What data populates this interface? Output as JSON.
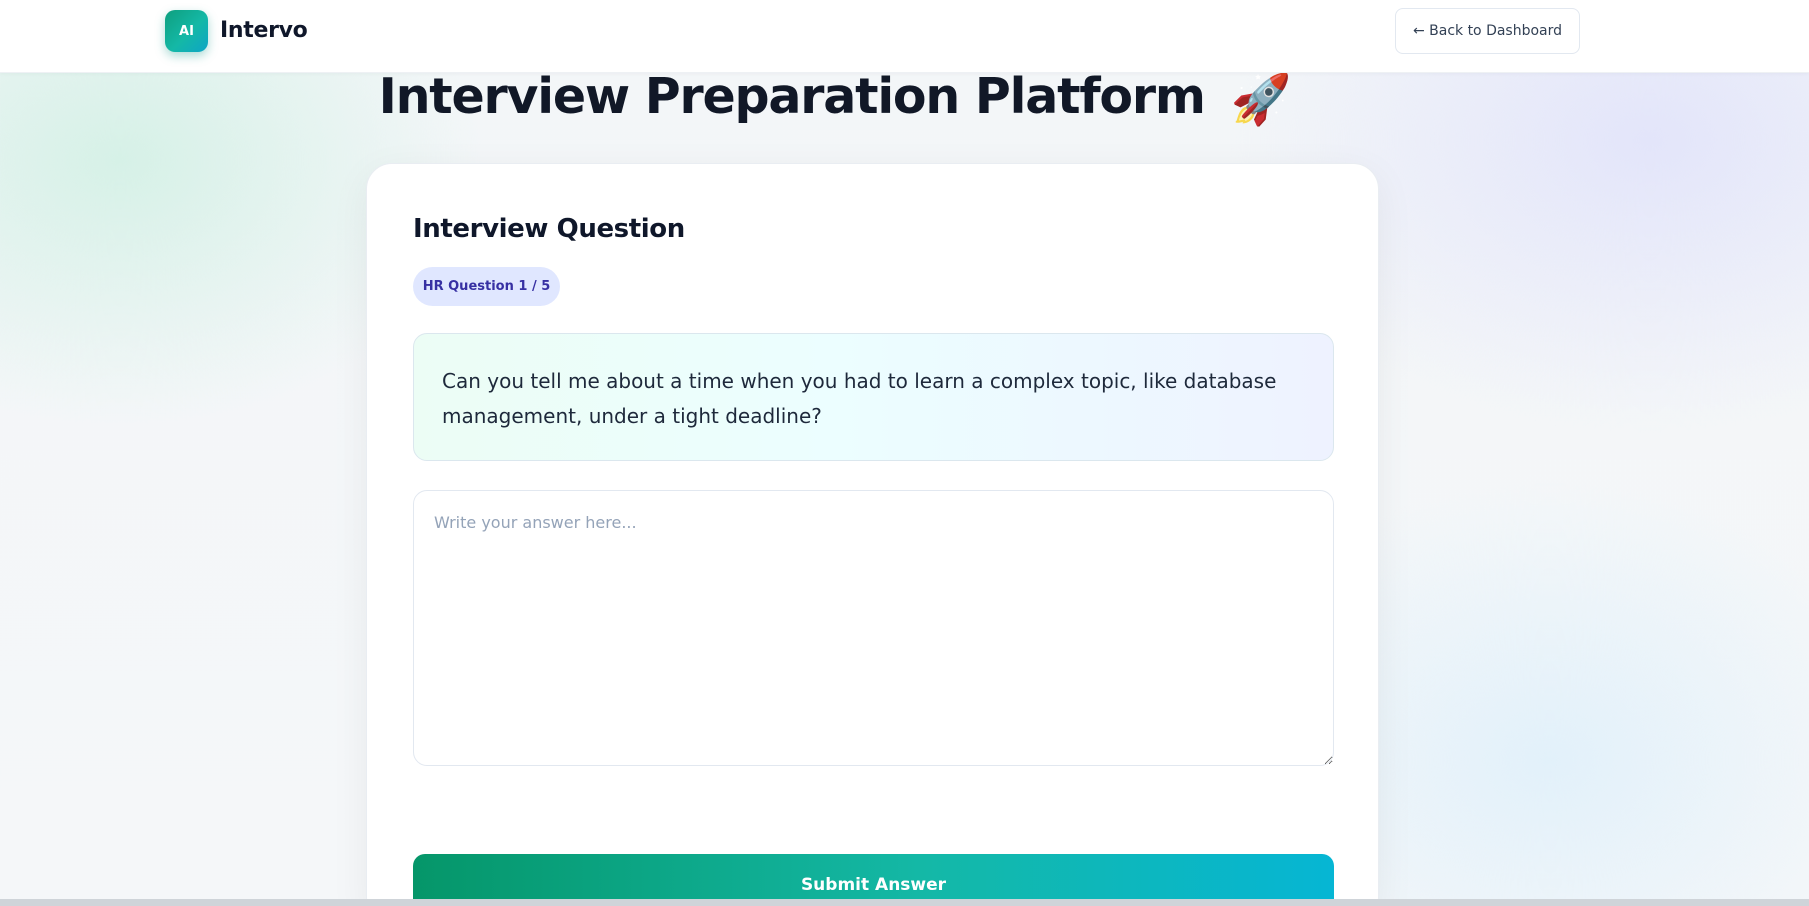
{
  "header": {
    "logo_text": "AI",
    "brand": "Intervo",
    "back_label": "← Back to Dashboard"
  },
  "page": {
    "title": "Interview Preparation Platform",
    "title_emoji": "🚀"
  },
  "card": {
    "heading": "Interview Question",
    "badge": "HR Question 1 / 5",
    "question": "Can you tell me about a time when you had to learn a complex topic, like database management, under a tight deadline?",
    "answer_placeholder": "Write your answer here...",
    "answer_value": "",
    "submit_label": "Submit Answer"
  },
  "colors": {
    "accent_start": "#059669",
    "accent_end": "#06b6d4",
    "badge_bg": "#e0e7ff",
    "badge_text": "#3730a3"
  }
}
